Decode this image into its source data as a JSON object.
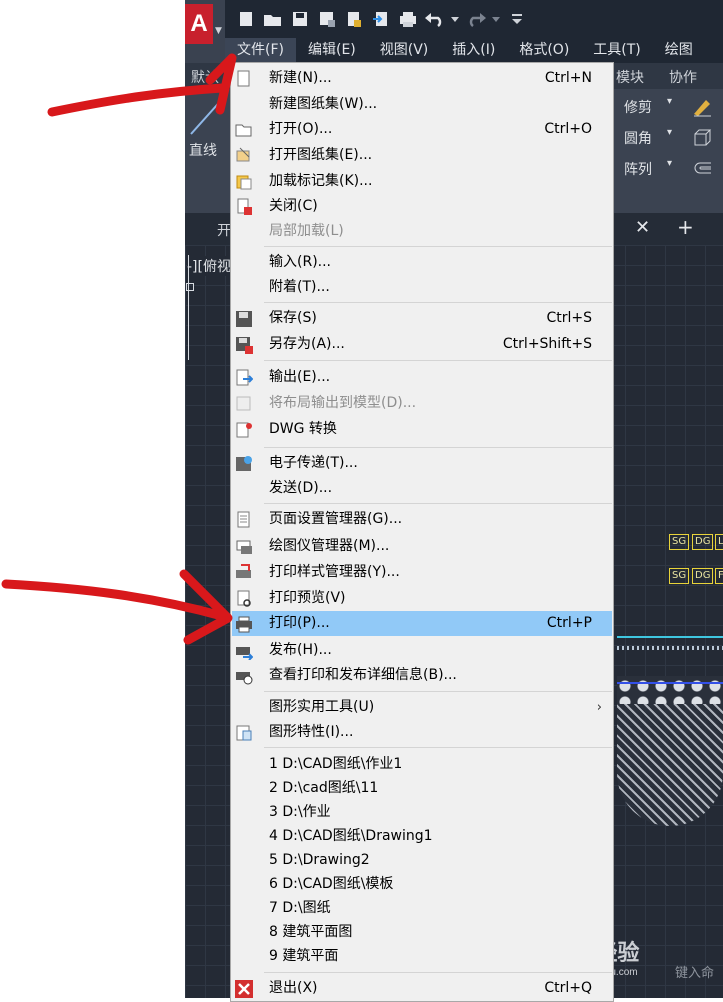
{
  "menubar": [
    "文件(F)",
    "编辑(E)",
    "视图(V)",
    "插入(I)",
    "格式(O)",
    "工具(T)",
    "绘图"
  ],
  "ribbon": {
    "tabs": [
      "默认",
      "模块",
      "协作"
    ],
    "line_tool": "直线",
    "modify": [
      "修剪",
      "圆角",
      "阵列"
    ]
  },
  "doc_tab": "开",
  "viewport_label": "-][俯视",
  "tags": [
    "SG",
    "DG",
    "L",
    "SG",
    "DG",
    "F"
  ],
  "file_menu": {
    "items": [
      {
        "label": "新建(N)...",
        "shortcut": "Ctrl+N",
        "icon": "new-file-icon"
      },
      {
        "label": "新建图纸集(W)...",
        "shortcut": "",
        "icon": ""
      },
      {
        "label": "打开(O)...",
        "shortcut": "Ctrl+O",
        "icon": "open-folder-icon"
      },
      {
        "label": "打开图纸集(E)...",
        "shortcut": "",
        "icon": "sheet-set-icon"
      },
      {
        "label": "加载标记集(K)...",
        "shortcut": "",
        "icon": "markup-icon"
      },
      {
        "label": "关闭(C)",
        "shortcut": "",
        "icon": "close-file-icon"
      },
      {
        "label": "局部加载(L)",
        "shortcut": "",
        "icon": "",
        "disabled": true
      },
      {
        "label": "输入(R)...",
        "shortcut": "",
        "icon": ""
      },
      {
        "label": "附着(T)...",
        "shortcut": "",
        "icon": ""
      },
      {
        "label": "保存(S)",
        "shortcut": "Ctrl+S",
        "icon": "save-icon"
      },
      {
        "label": "另存为(A)...",
        "shortcut": "Ctrl+Shift+S",
        "icon": "save-as-icon"
      },
      {
        "label": "输出(E)...",
        "shortcut": "",
        "icon": "export-icon"
      },
      {
        "label": "将布局输出到模型(D)...",
        "shortcut": "",
        "icon": "layout-export-icon",
        "disabled": true
      },
      {
        "label": "DWG 转换",
        "shortcut": "",
        "icon": "dwg-convert-icon"
      },
      {
        "label": "电子传递(T)...",
        "shortcut": "",
        "icon": "etransmit-icon"
      },
      {
        "label": "发送(D)...",
        "shortcut": "",
        "icon": ""
      },
      {
        "label": "页面设置管理器(G)...",
        "shortcut": "",
        "icon": "page-setup-icon"
      },
      {
        "label": "绘图仪管理器(M)...",
        "shortcut": "",
        "icon": "plotter-icon"
      },
      {
        "label": "打印样式管理器(Y)...",
        "shortcut": "",
        "icon": "plot-style-icon"
      },
      {
        "label": "打印预览(V)",
        "shortcut": "",
        "icon": "plot-preview-icon"
      },
      {
        "label": "打印(P)...",
        "shortcut": "Ctrl+P",
        "icon": "printer-icon",
        "highlighted": true
      },
      {
        "label": "发布(H)...",
        "shortcut": "",
        "icon": "publish-icon"
      },
      {
        "label": "查看打印和发布详细信息(B)...",
        "shortcut": "",
        "icon": "plot-details-icon"
      },
      {
        "label": "图形实用工具(U)",
        "shortcut": "",
        "icon": "",
        "submenu": true
      },
      {
        "label": "图形特性(I)...",
        "shortcut": "",
        "icon": "drawing-properties-icon"
      },
      {
        "label": "1 D:\\CAD图纸\\作业1",
        "shortcut": "",
        "icon": ""
      },
      {
        "label": "2 D:\\cad图纸\\11",
        "shortcut": "",
        "icon": ""
      },
      {
        "label": "3 D:\\作业",
        "shortcut": "",
        "icon": ""
      },
      {
        "label": "4 D:\\CAD图纸\\Drawing1",
        "shortcut": "",
        "icon": ""
      },
      {
        "label": "5 D:\\Drawing2",
        "shortcut": "",
        "icon": ""
      },
      {
        "label": "6 D:\\CAD图纸\\模板",
        "shortcut": "",
        "icon": ""
      },
      {
        "label": "7 D:\\图纸",
        "shortcut": "",
        "icon": ""
      },
      {
        "label": "8 建筑平面图",
        "shortcut": "",
        "icon": ""
      },
      {
        "label": "9 建筑平面",
        "shortcut": "",
        "icon": ""
      },
      {
        "label": "退出(X)",
        "shortcut": "Ctrl+Q",
        "icon": "exit-icon"
      }
    ],
    "submenu_glyph": "›"
  },
  "watermark": {
    "brand": "Bai 经验",
    "url": "jingyan.baidu.com"
  },
  "command_hint": "键入命",
  "colors": {
    "menu_highlight": "#91c9f7",
    "annotation_red": "#d8181b",
    "autocad_red": "#c8202d"
  }
}
